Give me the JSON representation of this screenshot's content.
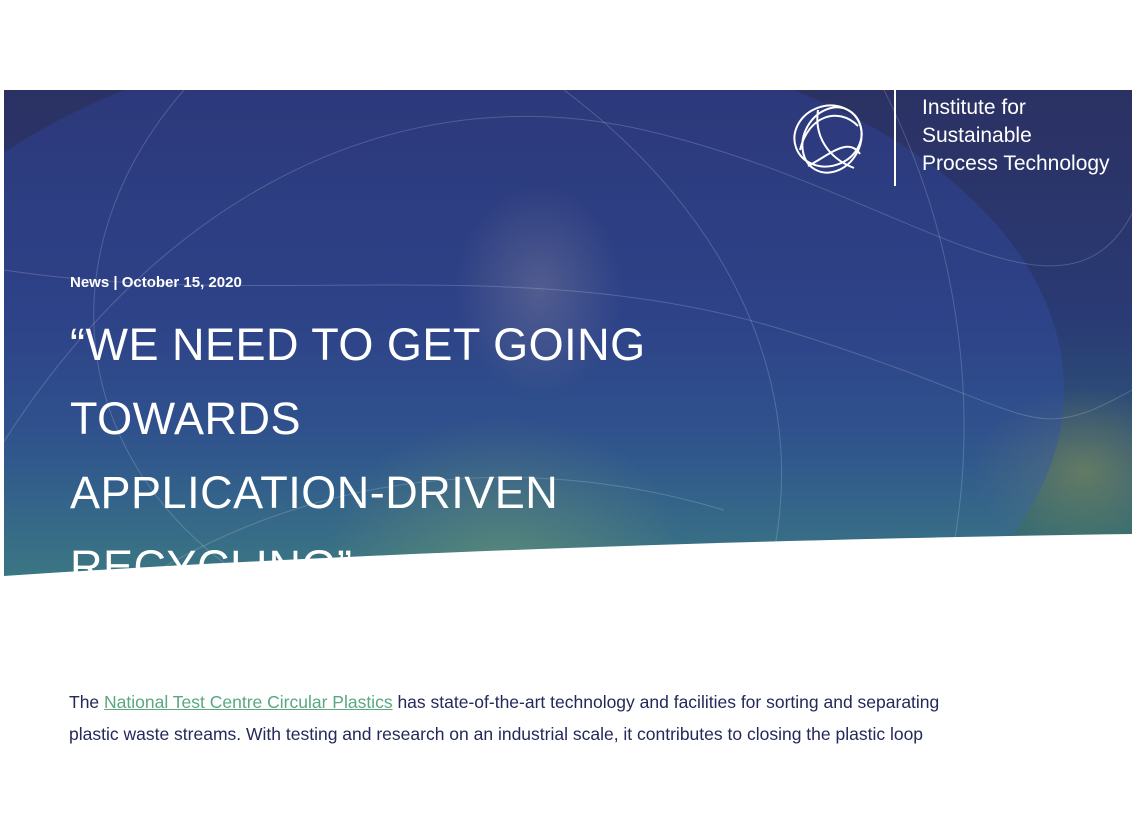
{
  "hero": {
    "logo": {
      "line1": "Institute for",
      "line2": "Sustainable",
      "line3": "Process Technology"
    },
    "meta": "News | October 15, 2020",
    "headline_line1": "“WE NEED TO GET GOING TOWARDS",
    "headline_line2": "APPLICATION-DRIVEN RECYCLING”"
  },
  "intro": {
    "prefix": "The ",
    "link_text": "National Test Centre Circular Plastics",
    "suffix": " has state-of-the-art technology and facilities for sorting and separating plastic waste streams. With testing and research on an industrial scale, it contributes to closing the plastic loop"
  },
  "colors": {
    "hero_dark": "#1e2350",
    "hero_blue": "#2d3c8c",
    "hero_green": "#46a08c",
    "body_text": "#24285a",
    "link": "#5aa784"
  },
  "icons": {
    "logo": "intertwined-loops-logo"
  }
}
